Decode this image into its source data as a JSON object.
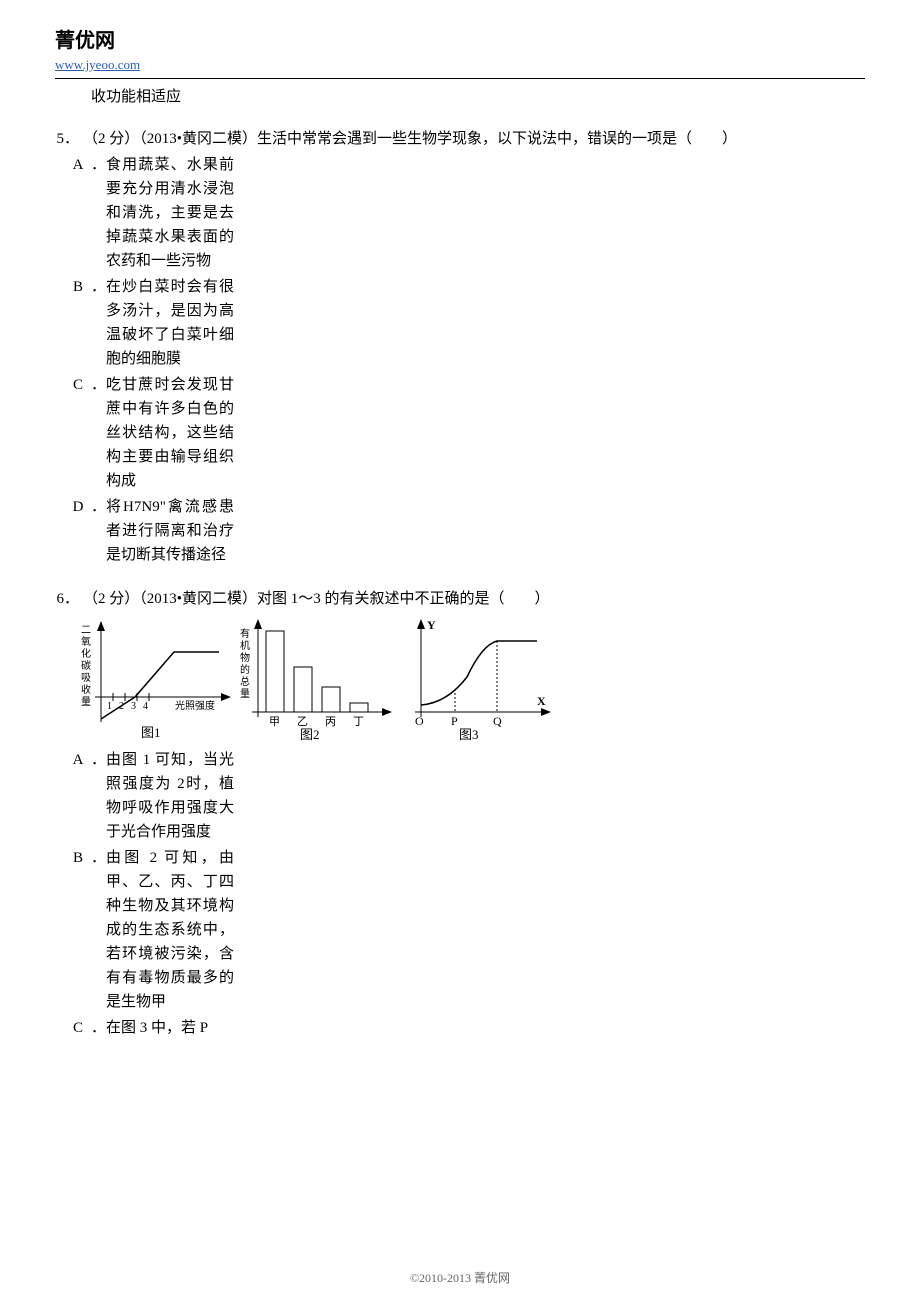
{
  "brand": {
    "name": "菁优网",
    "url": "www.jyeoo.com"
  },
  "prev_tail": "收功能相适应",
  "q5": {
    "num": "5．",
    "stem": "（2 分）（2013•黄冈二模）生活中常常会遇到一些生物学现象，以下说法中，错误的一项是（　　）",
    "A": "食用蔬菜、水果前要充分用清水浸泡和清洗，主要是去掉蔬菜水果表面的农药和一些污物",
    "B": "在炒白菜时会有很多汤汁，是因为高温破坏了白菜叶细胞的细胞膜",
    "C": "吃甘蔗时会发现甘蔗中有许多白色的丝状结构，这些结构主要由输导组织构成",
    "D": "将H7N9\"禽流感患者进行隔离和治疗是切断其传播途径"
  },
  "q6": {
    "num": "6．",
    "stem": "（2 分）（2013•黄冈二模）对图 1～3 的有关叙述中不正确的是（　　）",
    "A": "由图 1 可知，当光照强度为 2时，植物呼吸作用强度大于光合作用强度",
    "B": "由图 2 可知，由甲、乙、丙、丁四种生物及其环境构成的生态系统中，若环境被污染，含有有毒物质最多的是生物甲",
    "C_first": "在图 3 中，若 P"
  },
  "fig_labels": {
    "f1": "图1",
    "f2": "图2",
    "f3": "图3",
    "y1": "二氧化碳吸收量",
    "x1": "光照强度",
    "y2": "有机物的总量",
    "b1": "甲",
    "b2": "乙",
    "b3": "丙",
    "b4": "丁",
    "y3": "Y",
    "x3": "X",
    "o": "O",
    "p": "P",
    "q": "Q"
  },
  "chart_data": [
    {
      "type": "line",
      "title": "图1",
      "xlabel": "光照强度",
      "ylabel": "二氧化碳吸收量",
      "x_ticks": [
        1,
        2,
        3,
        4
      ],
      "points": [
        {
          "x": 0,
          "y": -10
        },
        {
          "x": 3,
          "y": 0
        },
        {
          "x": 5,
          "y": 12
        },
        {
          "x": 8,
          "y": 12
        }
      ]
    },
    {
      "type": "bar",
      "title": "图2",
      "xlabel": "",
      "ylabel": "有机物的总量",
      "categories": [
        "甲",
        "乙",
        "丙",
        "丁"
      ],
      "values": [
        100,
        55,
        30,
        10
      ]
    },
    {
      "type": "line",
      "title": "图3",
      "xlabel": "X",
      "ylabel": "Y",
      "x_marks": [
        "O",
        "P",
        "Q"
      ],
      "points": [
        {
          "x": 0,
          "y": 2
        },
        {
          "x": 3,
          "y": 3
        },
        {
          "x": 6,
          "y": 20
        },
        {
          "x": 10,
          "y": 20
        }
      ]
    }
  ],
  "footer": "©2010-2013  菁优网"
}
